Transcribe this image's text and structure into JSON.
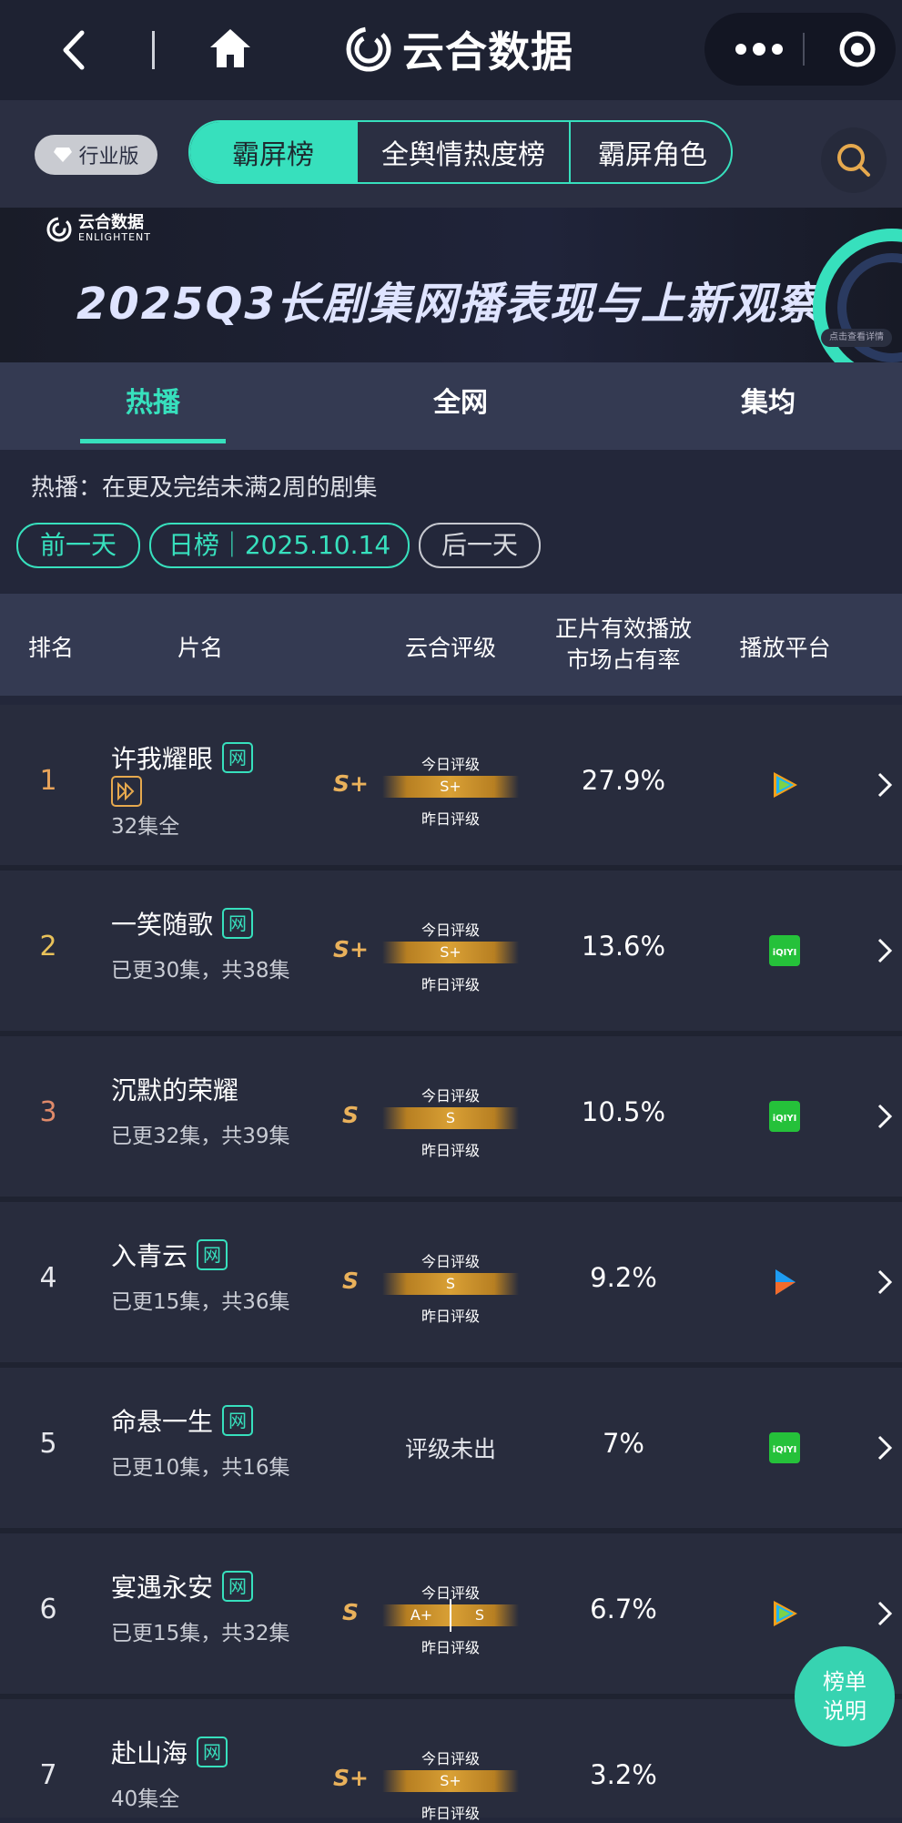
{
  "app": {
    "title": "云合数据"
  },
  "nav": {
    "badge": "行业版",
    "segments": [
      "霸屏榜",
      "全舆情热度榜",
      "霸屏角色"
    ]
  },
  "banner": {
    "logo_text": "云合数据",
    "logo_sub": "ENLIGHTENT",
    "title": "2025Q3长剧集网播表现与上新观察",
    "button": "点击查看详情"
  },
  "tabs": [
    "热播",
    "全网",
    "集均"
  ],
  "description": "热播：在更及完结未满2周的剧集",
  "date_nav": {
    "prev": "前一天",
    "current": "日榜｜2025.10.14",
    "next": "后一天"
  },
  "table_headers": {
    "rank": "排名",
    "title": "片名",
    "rating": "云合评级",
    "share_line1": "正片有效播放",
    "share_line2": "市场占有率",
    "platform": "播放平台"
  },
  "rating_labels": {
    "today": "今日评级",
    "yesterday": "昨日评级"
  },
  "rows": [
    {
      "rank": "1",
      "title": "许我耀眼",
      "badge": "网",
      "sub": "32集全",
      "rating": "S+",
      "today": "S+",
      "share": "27.9%",
      "platform": "tencent-video"
    },
    {
      "rank": "2",
      "title": "一笑随歌",
      "badge": "网",
      "sub": "已更30集，共38集",
      "rating": "S+",
      "today": "S+",
      "share": "13.6%",
      "platform": "iqiyi"
    },
    {
      "rank": "3",
      "title": "沉默的荣耀",
      "badge": "",
      "sub": "已更32集，共39集",
      "rating": "S",
      "today": "S",
      "share": "10.5%",
      "platform": "iqiyi"
    },
    {
      "rank": "4",
      "title": "入青云",
      "badge": "网",
      "sub": "已更15集，共36集",
      "rating": "S",
      "today": "S",
      "share": "9.2%",
      "platform": "youku"
    },
    {
      "rank": "5",
      "title": "命悬一生",
      "badge": "网",
      "sub": "已更10集，共16集",
      "rating": "评级未出",
      "today": "",
      "share": "7%",
      "platform": "iqiyi"
    },
    {
      "rank": "6",
      "title": "宴遇永安",
      "badge": "网",
      "sub": "已更15集，共32集",
      "rating": "S",
      "today": "S",
      "yesterday": "A+",
      "share": "6.7%",
      "platform": "tencent-video"
    },
    {
      "rank": "7",
      "title": "赴山海",
      "badge": "网",
      "sub": "40集全",
      "rating": "S+",
      "today": "S+",
      "share": "3.2%",
      "platform": ""
    }
  ],
  "fab": {
    "line1": "榜单",
    "line2": "说明"
  },
  "colors": {
    "accent": "#37e0bd",
    "gold": "#e9b15b",
    "rank_gold": "#e9a45a"
  }
}
